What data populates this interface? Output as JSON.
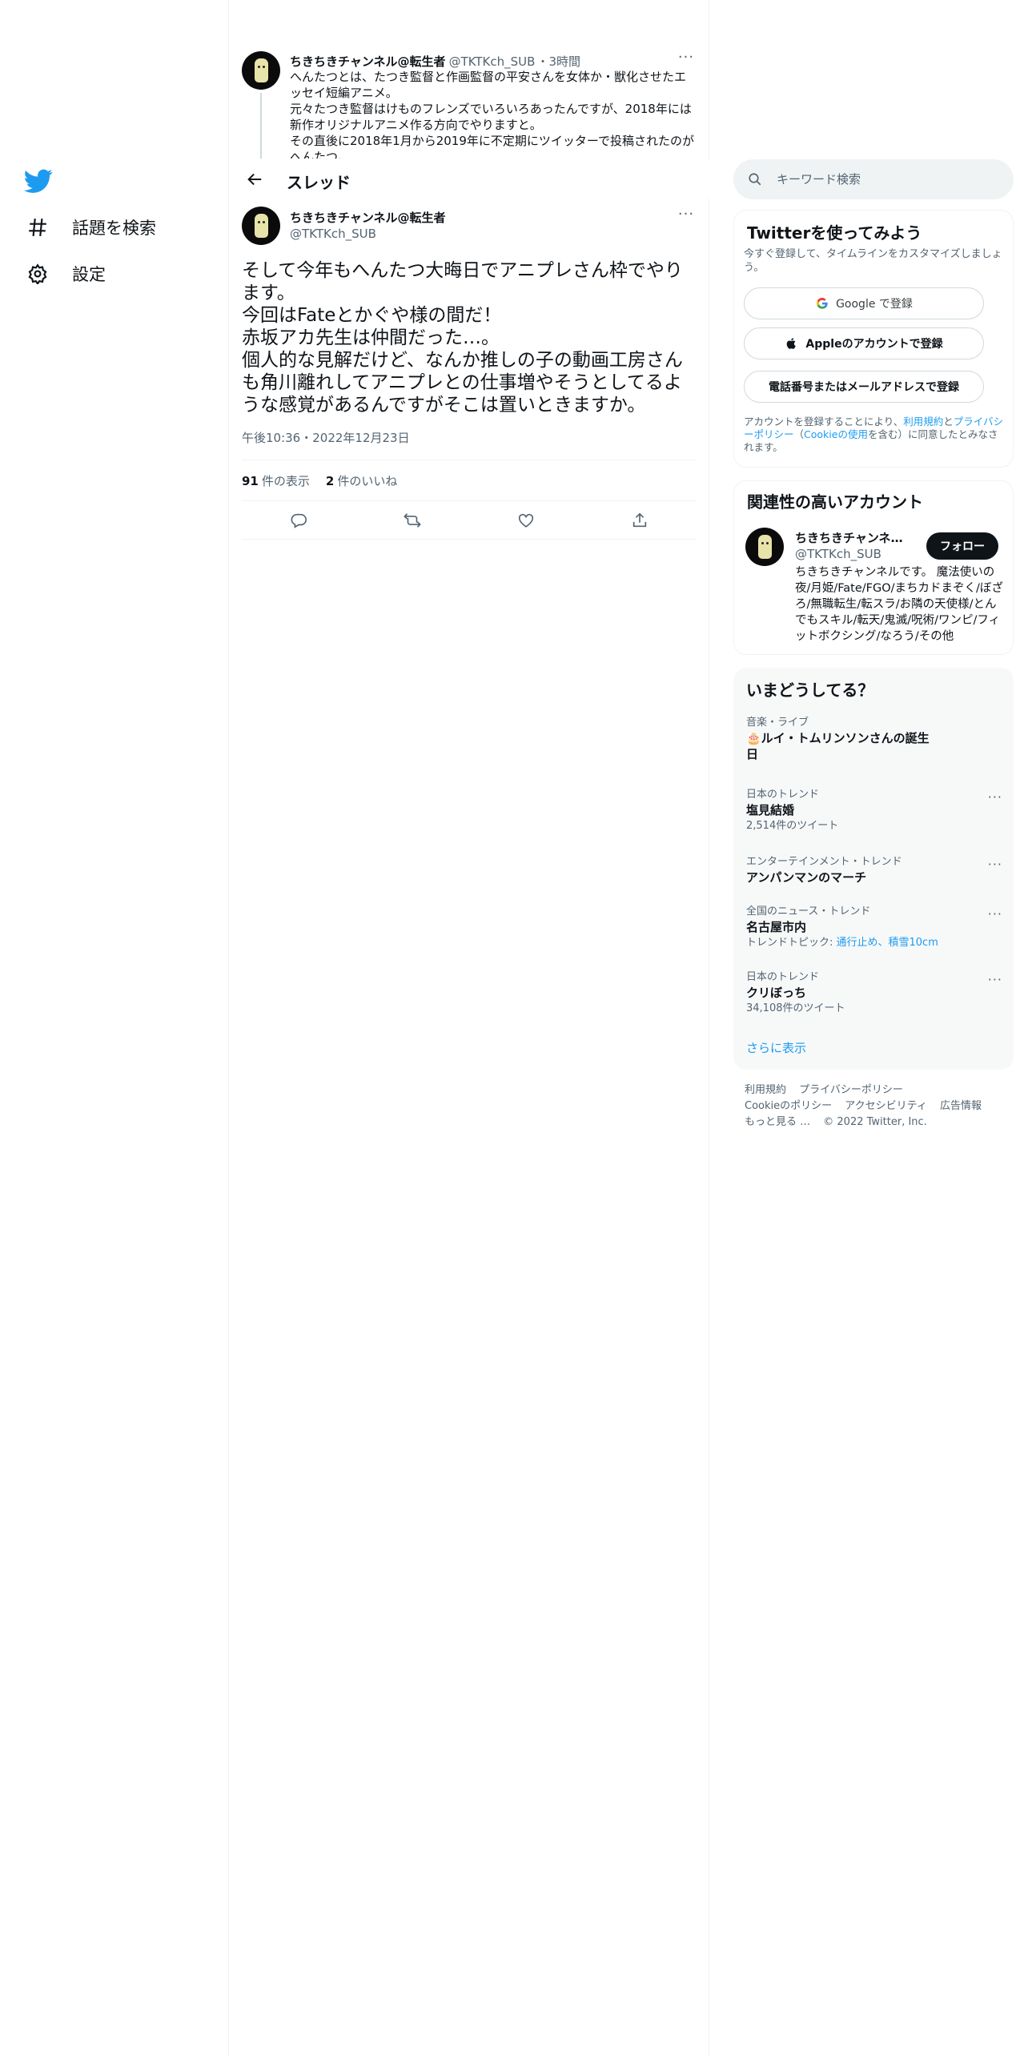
{
  "left_nav": {
    "items": [
      {
        "label": "話題を検索",
        "icon": "hashtag-icon"
      },
      {
        "label": "設定",
        "icon": "gear-icon"
      }
    ]
  },
  "colors": {
    "accent": "#1d9bf0",
    "text": "#0f1419",
    "secondary": "#536471",
    "border": "#eff3f4"
  },
  "prev_tweet": {
    "name": "ちきちきチャンネル@転生者",
    "handle": "@TKTKch_SUB",
    "time": "・3時間",
    "body": "へんたつとは、たつき監督と作画監督の平安さんを女体か・獣化させたエッセイ短編アニメ。\n元々たつき監督はけものフレンズでいろいろあったんですが、2018年には新作オリジナルアニメ作る方向でやりますと。\nその直後に2018年1月から2019年に不定期にツイッターで投稿されたのがへんたつ。"
  },
  "header": {
    "title": "スレッド"
  },
  "main_tweet": {
    "name": "ちきちきチャンネル@転生者",
    "handle": "@TKTKch_SUB",
    "body": "そして今年もへんたつ大晦日でアニプレさん枠でやります。\n今回はFateとかぐや様の間だ！\n赤坂アカ先生は仲間だった…。\n個人的な見解だけど、なんか推しの子の動画工房さんも角川離れしてアニプレとの仕事増やそうとしてるような感覚があるんですがそこは置いときますか。",
    "timestamp": "午後10:36・2022年12月23日",
    "views_count": "91",
    "views_label": "件の表示",
    "likes_count": "2",
    "likes_label": "件のいいね"
  },
  "search": {
    "placeholder": "キーワード検索"
  },
  "signup": {
    "title": "Twitterを使ってみよう",
    "subtitle": "今すぐ登録して、タイムラインをカスタマイズしましょう。",
    "google_label": "Google で登録",
    "apple_label": "Appleのアカウントで登録",
    "phone_label": "電話番号またはメールアドレスで登録",
    "legal_1": "アカウントを登録することにより、",
    "legal_terms": "利用規約",
    "legal_2": "と",
    "legal_privacy": "プライバシーポリシー",
    "legal_3": "（",
    "legal_cookie": "Cookieの使用",
    "legal_4": "を含む）に同意したとみなされます。"
  },
  "related": {
    "title": "関連性の高いアカウント",
    "name": "ちきちきチャンネル@転生者",
    "handle": "@TKTKch_SUB",
    "follow_label": "フォロー",
    "bio": "ちきちきチャンネルです。 魔法使いの夜/月姫/Fate/FGO/まちカドまぞく/ぼざろ/無職転生/転スラ/お隣の天使様/とんでもスキル/転天/鬼滅/呪術/ワンピ/フィットボクシング/なろう/その他"
  },
  "trends": {
    "title": "いまどうしてる？",
    "items": [
      {
        "category": "音楽・ライブ",
        "name": "🎂ルイ・トムリンソンさんの誕生日",
        "meta": "",
        "more": ""
      },
      {
        "category": "日本のトレンド",
        "name": "塩見結婚",
        "meta": "2,514件のツイート",
        "more": "···"
      },
      {
        "category": "エンターテインメント・トレンド",
        "name": "アンパンマンのマーチ",
        "meta": "",
        "more": "···"
      },
      {
        "category": "全国のニュース・トレンド",
        "name": "名古屋市内",
        "meta": "トレンドトピック: ",
        "meta_link": "通行止め、積雪10cm",
        "more": "···"
      },
      {
        "category": "日本のトレンド",
        "name": "クリぼっち",
        "meta": "34,108件のツイート",
        "more": "···"
      }
    ],
    "show_more": "さらに表示"
  },
  "footer": {
    "links": [
      "利用規約",
      "プライバシーポリシー",
      "Cookieのポリシー",
      "アクセシビリティ",
      "広告情報",
      "もっと見る …",
      "© 2022 Twitter, Inc."
    ]
  }
}
